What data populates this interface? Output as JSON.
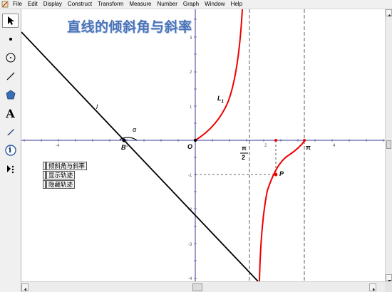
{
  "menu": {
    "items": [
      "File",
      "Edit",
      "Display",
      "Construct",
      "Transform",
      "Measure",
      "Number",
      "Graph",
      "Window",
      "Help"
    ]
  },
  "toolbox": {
    "tools": [
      {
        "name": "arrow",
        "icon": "arrow-select-icon",
        "selected": true
      },
      {
        "name": "point",
        "icon": "point-icon"
      },
      {
        "name": "compass",
        "icon": "compass-circle-icon"
      },
      {
        "name": "straightedge",
        "icon": "segment-icon"
      },
      {
        "name": "polygon",
        "icon": "polygon-icon"
      },
      {
        "name": "text",
        "icon": "text-a-icon",
        "label": "A"
      },
      {
        "name": "marker",
        "icon": "marker-pen-icon"
      },
      {
        "name": "information",
        "icon": "info-icon",
        "label": "i"
      },
      {
        "name": "custom",
        "icon": "custom-tool-icon"
      }
    ]
  },
  "canvas": {
    "title": "直线的倾斜角与斜率",
    "buttons": [
      "倾斜角与斜率",
      "显示轨迹",
      "隐藏轨迹"
    ],
    "labels": {
      "line": "l",
      "angle": "α",
      "point_b": "B",
      "origin": "O",
      "curve": "L",
      "curve_sub": "1",
      "point_p": "P",
      "pi": "π",
      "half_pi_num": "π",
      "half_pi_den": "2"
    },
    "x_ticks": [
      "-4",
      "-2",
      "2",
      "4"
    ],
    "y_ticks": [
      "3",
      "2",
      "1",
      "-1",
      "-2",
      "-3",
      "-4"
    ],
    "colors": {
      "curve": "#ee0000",
      "axes": "#3a3a9a",
      "line": "#000000",
      "title": "#4a74b8"
    }
  }
}
